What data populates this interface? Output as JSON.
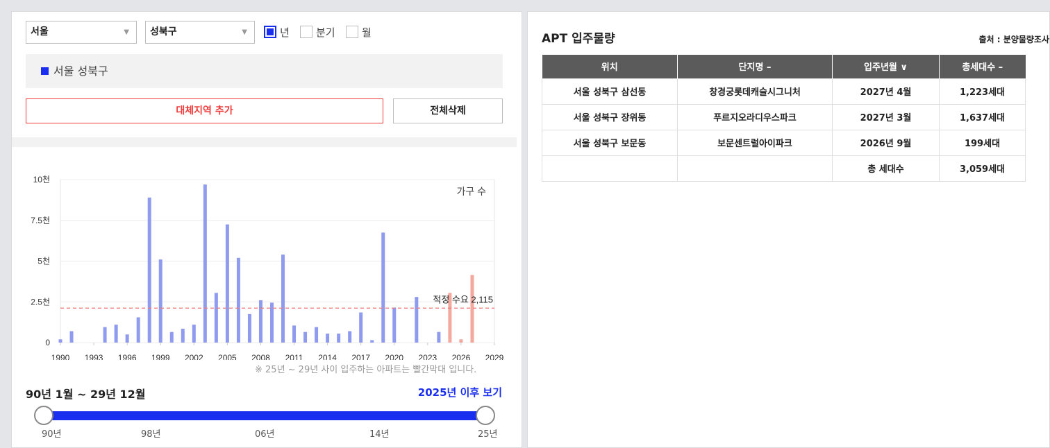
{
  "filters": {
    "city": "서울",
    "district": "성북구",
    "period_options": [
      {
        "label": "년",
        "checked": true
      },
      {
        "label": "분기",
        "checked": false
      },
      {
        "label": "월",
        "checked": false
      }
    ]
  },
  "region_tag": "서울 성북구",
  "buttons": {
    "add_region": "대체지역 추가",
    "delete_all": "전체삭제"
  },
  "chart_data": {
    "type": "bar",
    "legend": "가구 수",
    "ylim": [
      0,
      10000
    ],
    "yticks": [
      {
        "value": 0,
        "label": "0"
      },
      {
        "value": 2500,
        "label": "2.5천"
      },
      {
        "value": 5000,
        "label": "5천"
      },
      {
        "value": 7500,
        "label": "7.5천"
      },
      {
        "value": 10000,
        "label": "10천"
      }
    ],
    "xlim": [
      1990,
      2029
    ],
    "xticks": [
      "1990",
      "1993",
      "1996",
      "1999",
      "2002",
      "2005",
      "2008",
      "2011",
      "2014",
      "2017",
      "2020",
      "2023",
      "2026",
      "2029"
    ],
    "reference_line": {
      "value": 2115,
      "label": "적정 수요 2,115"
    },
    "colors": {
      "past": "#8f9bef",
      "future": "#f4a99f",
      "reference": "#f27a7a"
    },
    "bars": [
      {
        "year": 1990,
        "value": 200
      },
      {
        "year": 1991,
        "value": 700
      },
      {
        "year": 1994,
        "value": 950
      },
      {
        "year": 1995,
        "value": 1100
      },
      {
        "year": 1996,
        "value": 500
      },
      {
        "year": 1997,
        "value": 1550
      },
      {
        "year": 1998,
        "value": 8900
      },
      {
        "year": 1999,
        "value": 5100
      },
      {
        "year": 2000,
        "value": 650
      },
      {
        "year": 2001,
        "value": 850
      },
      {
        "year": 2002,
        "value": 1100
      },
      {
        "year": 2003,
        "value": 9700
      },
      {
        "year": 2004,
        "value": 3050
      },
      {
        "year": 2005,
        "value": 7250
      },
      {
        "year": 2006,
        "value": 5200
      },
      {
        "year": 2007,
        "value": 1750
      },
      {
        "year": 2008,
        "value": 2600
      },
      {
        "year": 2009,
        "value": 2450
      },
      {
        "year": 2010,
        "value": 5400
      },
      {
        "year": 2011,
        "value": 1050
      },
      {
        "year": 2012,
        "value": 650
      },
      {
        "year": 2013,
        "value": 950
      },
      {
        "year": 2014,
        "value": 550
      },
      {
        "year": 2015,
        "value": 550
      },
      {
        "year": 2016,
        "value": 700
      },
      {
        "year": 2017,
        "value": 1850
      },
      {
        "year": 2018,
        "value": 150
      },
      {
        "year": 2019,
        "value": 6750
      },
      {
        "year": 2020,
        "value": 2150
      },
      {
        "year": 2022,
        "value": 2800
      },
      {
        "year": 2024,
        "value": 650
      },
      {
        "year": 2025,
        "value": 3050,
        "future": true
      },
      {
        "year": 2026,
        "value": 200,
        "future": true
      },
      {
        "year": 2027,
        "value": 4150,
        "future": true
      }
    ]
  },
  "note": "※ 25년 ~ 29년 사이 입주하는 아파트는 빨간막대 입니다.",
  "range": {
    "label": "90년 1월 ~ 29년 12월",
    "after_link": "2025년 이후 보기",
    "ticks": [
      "90년",
      "98년",
      "06년",
      "14년",
      "25년"
    ]
  },
  "table": {
    "title": "APT 입주물량",
    "source": "출처 : 분양물량조사",
    "headers": [
      "위치",
      "단지명 –",
      "입주년월 ∨",
      "총세대수 –"
    ],
    "rows": [
      [
        "서울 성북구 삼선동",
        "창경궁롯데캐슬시그니처",
        "2027년 4월",
        "1,223세대"
      ],
      [
        "서울 성북구 장위동",
        "푸르지오라디우스파크",
        "2027년 3월",
        "1,637세대"
      ],
      [
        "서울 성북구 보문동",
        "보문센트럴아이파크",
        "2026년 9월",
        "199세대"
      ],
      [
        "",
        "",
        "총 세대수",
        "3,059세대"
      ]
    ]
  }
}
